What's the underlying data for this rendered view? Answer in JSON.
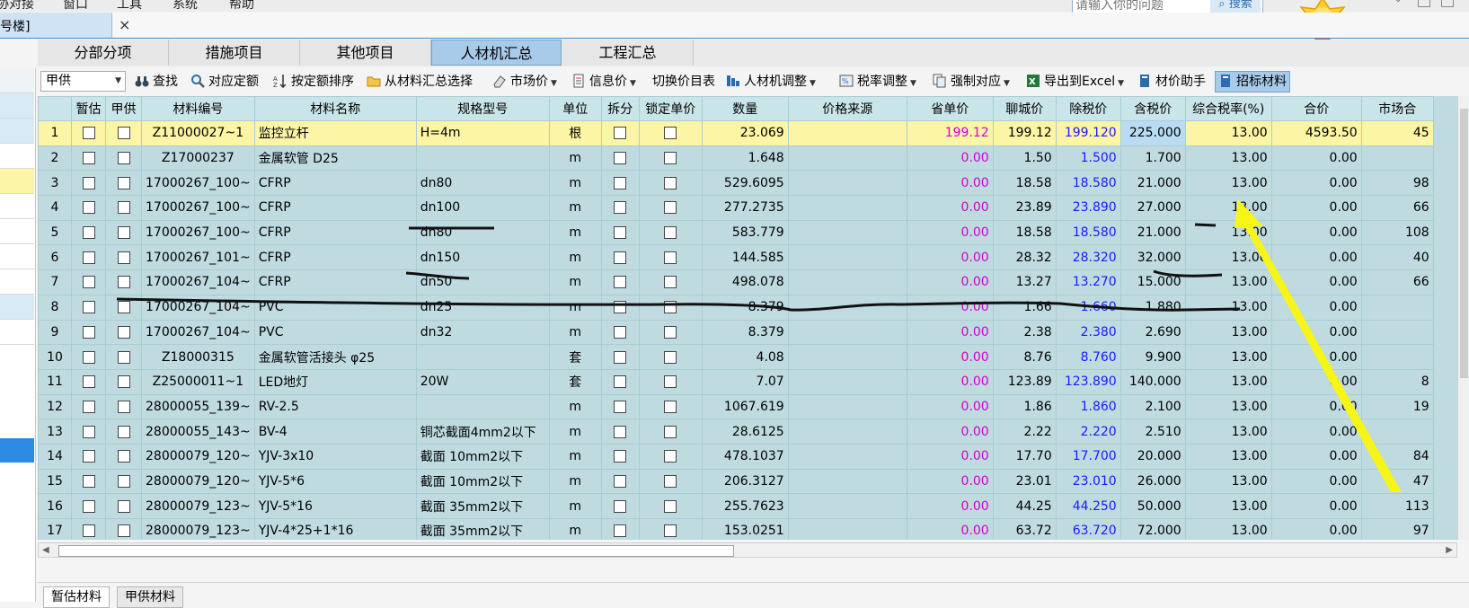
{
  "menubar": {
    "items": [
      "协对接",
      "窗口",
      "工具",
      "系统",
      "帮助"
    ]
  },
  "search": {
    "placeholder": "请输入你的问题",
    "button": "搜索"
  },
  "doc_tab": {
    "label": "号楼]",
    "close": "×"
  },
  "subtabs": [
    {
      "label": "分部分项",
      "active": false
    },
    {
      "label": "措施项目",
      "active": false
    },
    {
      "label": "其他项目",
      "active": false
    },
    {
      "label": "人材机汇总",
      "active": true
    },
    {
      "label": "工程汇总",
      "active": false
    }
  ],
  "toolbar": {
    "supply_select": "甲供",
    "buttons": [
      {
        "label": "查找",
        "icon": "binoculars-icon",
        "caret": false
      },
      {
        "label": "对应定额",
        "icon": "magnifier-icon",
        "caret": false
      },
      {
        "label": "按定额排序",
        "icon": "sort-icon",
        "caret": false
      },
      {
        "label": "从材料汇总选择",
        "icon": "folder-icon",
        "caret": false
      },
      {
        "label": "市场价",
        "icon": "eraser-icon",
        "caret": true
      },
      {
        "label": "信息价",
        "icon": "document-icon",
        "caret": true
      },
      {
        "label": "切换价目表",
        "icon": "",
        "caret": false
      },
      {
        "label": "人材机调整",
        "icon": "adjust-icon",
        "caret": true
      },
      {
        "label": "税率调整",
        "icon": "tax-icon",
        "caret": true
      },
      {
        "label": "强制对应",
        "icon": "copy-icon",
        "caret": true
      },
      {
        "label": "导出到Excel",
        "icon": "excel-icon",
        "caret": true
      },
      {
        "label": "材价助手",
        "icon": "book-icon",
        "caret": false
      },
      {
        "label": "招标材料",
        "icon": "book-icon",
        "caret": false,
        "active": true
      }
    ]
  },
  "table": {
    "columns": [
      "",
      "暂估",
      "甲供",
      "材料编号",
      "材料名称",
      "规格型号",
      "单位",
      "拆分",
      "锁定单价",
      "数量",
      "价格来源",
      "省单价",
      "聊城价",
      "除税价",
      "含税价",
      "综合税率(%)",
      "合价",
      "市场合"
    ],
    "rows": [
      {
        "no": "1",
        "code": "Z11000027~1",
        "name": "监控立杆",
        "spec": "H=4m",
        "unit": "根",
        "qty": "23.069",
        "src": "",
        "prov": "199.12",
        "lc": "199.12",
        "ex": "199.120",
        "inc": "225.000",
        "rate": "13.00",
        "total": "4593.50",
        "mkt": "45"
      },
      {
        "no": "2",
        "code": "Z17000237",
        "name": "金属软管 D25",
        "spec": "",
        "unit": "m",
        "qty": "1.648",
        "src": "",
        "prov": "0.00",
        "lc": "1.50",
        "ex": "1.500",
        "inc": "1.700",
        "rate": "13.00",
        "total": "0.00",
        "mkt": ""
      },
      {
        "no": "3",
        "code": "17000267_100~",
        "name": "CFRP",
        "spec": "dn80",
        "unit": "m",
        "qty": "529.6095",
        "src": "",
        "prov": "0.00",
        "lc": "18.58",
        "ex": "18.580",
        "inc": "21.000",
        "rate": "13.00",
        "total": "0.00",
        "mkt": "98"
      },
      {
        "no": "4",
        "code": "17000267_100~",
        "name": "CFRP",
        "spec": "dn100",
        "unit": "m",
        "qty": "277.2735",
        "src": "",
        "prov": "0.00",
        "lc": "23.89",
        "ex": "23.890",
        "inc": "27.000",
        "rate": "13.00",
        "total": "0.00",
        "mkt": "66"
      },
      {
        "no": "5",
        "code": "17000267_100~",
        "name": "CFRP",
        "spec": "dn80",
        "unit": "m",
        "qty": "583.779",
        "src": "",
        "prov": "0.00",
        "lc": "18.58",
        "ex": "18.580",
        "inc": "21.000",
        "rate": "13.00",
        "total": "0.00",
        "mkt": "108"
      },
      {
        "no": "6",
        "code": "17000267_101~",
        "name": "CFRP",
        "spec": "dn150",
        "unit": "m",
        "qty": "144.585",
        "src": "",
        "prov": "0.00",
        "lc": "28.32",
        "ex": "28.320",
        "inc": "32.000",
        "rate": "13.00",
        "total": "0.00",
        "mkt": "40"
      },
      {
        "no": "7",
        "code": "17000267_104~",
        "name": "CFRP",
        "spec": "dn50",
        "unit": "m",
        "qty": "498.078",
        "src": "",
        "prov": "0.00",
        "lc": "13.27",
        "ex": "13.270",
        "inc": "15.000",
        "rate": "13.00",
        "total": "0.00",
        "mkt": "66"
      },
      {
        "no": "8",
        "code": "17000267_104~",
        "name": "PVC",
        "spec": "dn25",
        "unit": "m",
        "qty": "8.379",
        "src": "",
        "prov": "0.00",
        "lc": "1.66",
        "ex": "1.660",
        "inc": "1.880",
        "rate": "13.00",
        "total": "0.00",
        "mkt": ""
      },
      {
        "no": "9",
        "code": "17000267_104~",
        "name": "PVC",
        "spec": "dn32",
        "unit": "m",
        "qty": "8.379",
        "src": "",
        "prov": "0.00",
        "lc": "2.38",
        "ex": "2.380",
        "inc": "2.690",
        "rate": "13.00",
        "total": "0.00",
        "mkt": ""
      },
      {
        "no": "10",
        "code": "Z18000315",
        "name": "金属软管活接头 φ25",
        "spec": "",
        "unit": "套",
        "qty": "4.08",
        "src": "",
        "prov": "0.00",
        "lc": "8.76",
        "ex": "8.760",
        "inc": "9.900",
        "rate": "13.00",
        "total": "0.00",
        "mkt": ""
      },
      {
        "no": "11",
        "code": "Z25000011~1",
        "name": "LED地灯",
        "spec": "20W",
        "unit": "套",
        "qty": "7.07",
        "src": "",
        "prov": "0.00",
        "lc": "123.89",
        "ex": "123.890",
        "inc": "140.000",
        "rate": "13.00",
        "total": "0.00",
        "mkt": "8"
      },
      {
        "no": "12",
        "code": "28000055_139~",
        "name": "RV-2.5",
        "spec": "",
        "unit": "m",
        "qty": "1067.619",
        "src": "",
        "prov": "0.00",
        "lc": "1.86",
        "ex": "1.860",
        "inc": "2.100",
        "rate": "13.00",
        "total": "0.00",
        "mkt": "19"
      },
      {
        "no": "13",
        "code": "28000055_143~",
        "name": "BV-4",
        "spec": "铜芯截面4mm2以下",
        "unit": "m",
        "qty": "28.6125",
        "src": "",
        "prov": "0.00",
        "lc": "2.22",
        "ex": "2.220",
        "inc": "2.510",
        "rate": "13.00",
        "total": "0.00",
        "mkt": ""
      },
      {
        "no": "14",
        "code": "28000079_120~",
        "name": "YJV-3x10",
        "spec": "截面 10mm2以下",
        "unit": "m",
        "qty": "478.1037",
        "src": "",
        "prov": "0.00",
        "lc": "17.70",
        "ex": "17.700",
        "inc": "20.000",
        "rate": "13.00",
        "total": "0.00",
        "mkt": "84"
      },
      {
        "no": "15",
        "code": "28000079_120~",
        "name": "YJV-5*6",
        "spec": "截面 10mm2以下",
        "unit": "m",
        "qty": "206.3127",
        "src": "",
        "prov": "0.00",
        "lc": "23.01",
        "ex": "23.010",
        "inc": "26.000",
        "rate": "13.00",
        "total": "0.00",
        "mkt": "47"
      },
      {
        "no": "16",
        "code": "28000079_123~",
        "name": "YJV-5*16",
        "spec": "截面 35mm2以下",
        "unit": "m",
        "qty": "255.7623",
        "src": "",
        "prov": "0.00",
        "lc": "44.25",
        "ex": "44.250",
        "inc": "50.000",
        "rate": "13.00",
        "total": "0.00",
        "mkt": "113"
      },
      {
        "no": "17",
        "code": "28000079_123~",
        "name": "YJV-4*25+1*16",
        "spec": "截面 35mm2以下",
        "unit": "m",
        "qty": "153.0251",
        "src": "",
        "prov": "0.00",
        "lc": "63.72",
        "ex": "63.720",
        "inc": "72.000",
        "rate": "13.00",
        "total": "0.00",
        "mkt": "97"
      }
    ]
  },
  "bottom_tabs": [
    {
      "label": "暂估材料",
      "active": true
    },
    {
      "label": "甲供材料",
      "active": false
    }
  ]
}
